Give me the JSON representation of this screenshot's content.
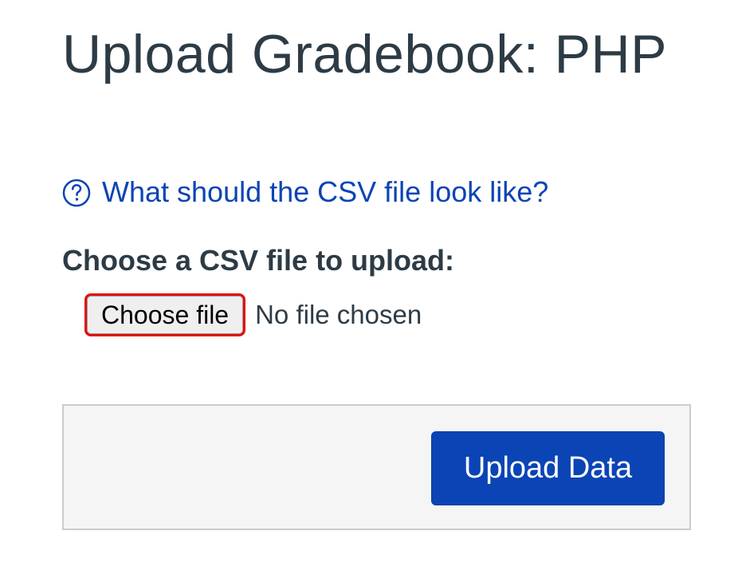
{
  "page": {
    "title": "Upload Gradebook: PHP"
  },
  "help": {
    "icon": "question-circle-icon",
    "link_text": "What should the CSV file look like?"
  },
  "file_upload": {
    "label": "Choose a CSV file to upload:",
    "button_label": "Choose file",
    "status_text": "No file chosen"
  },
  "actions": {
    "upload_label": "Upload Data"
  },
  "colors": {
    "text": "#2d3b45",
    "link": "#0b44b4",
    "primary_button": "#0b44b4",
    "highlight_outline": "#e20b0b",
    "footer_background": "#f5f5f5"
  }
}
